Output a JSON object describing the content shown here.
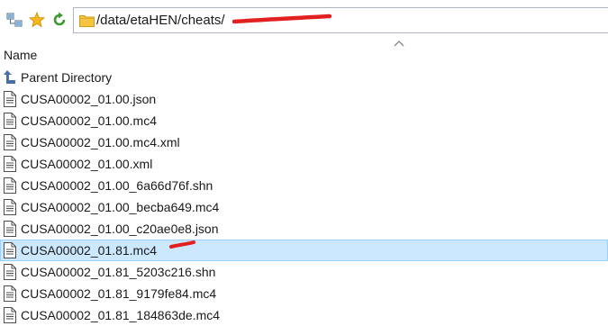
{
  "toolbar": {
    "icons": [
      "network-icon",
      "star-icon",
      "refresh-icon"
    ]
  },
  "address": {
    "path": "/data/etaHEN/cheats/"
  },
  "header": {
    "name_label": "Name"
  },
  "parent": {
    "label": "Parent Directory"
  },
  "files": [
    {
      "name": "CUSA00002_01.00.json"
    },
    {
      "name": "CUSA00002_01.00.mc4"
    },
    {
      "name": "CUSA00002_01.00.mc4.xml"
    },
    {
      "name": "CUSA00002_01.00.xml"
    },
    {
      "name": "CUSA00002_01.00_6a66d76f.shn"
    },
    {
      "name": "CUSA00002_01.00_becba649.mc4"
    },
    {
      "name": "CUSA00002_01.00_c20ae0e8.json"
    },
    {
      "name": "CUSA00002_01.81.mc4",
      "selected": true
    },
    {
      "name": "CUSA00002_01.81_5203c216.shn"
    },
    {
      "name": "CUSA00002_01.81_9179fe84.mc4"
    },
    {
      "name": "CUSA00002_01.81_184863de.mc4"
    }
  ],
  "colors": {
    "selection_fill": "#cce8ff",
    "selection_border": "#99d1ff",
    "annotation": "#e32020"
  }
}
